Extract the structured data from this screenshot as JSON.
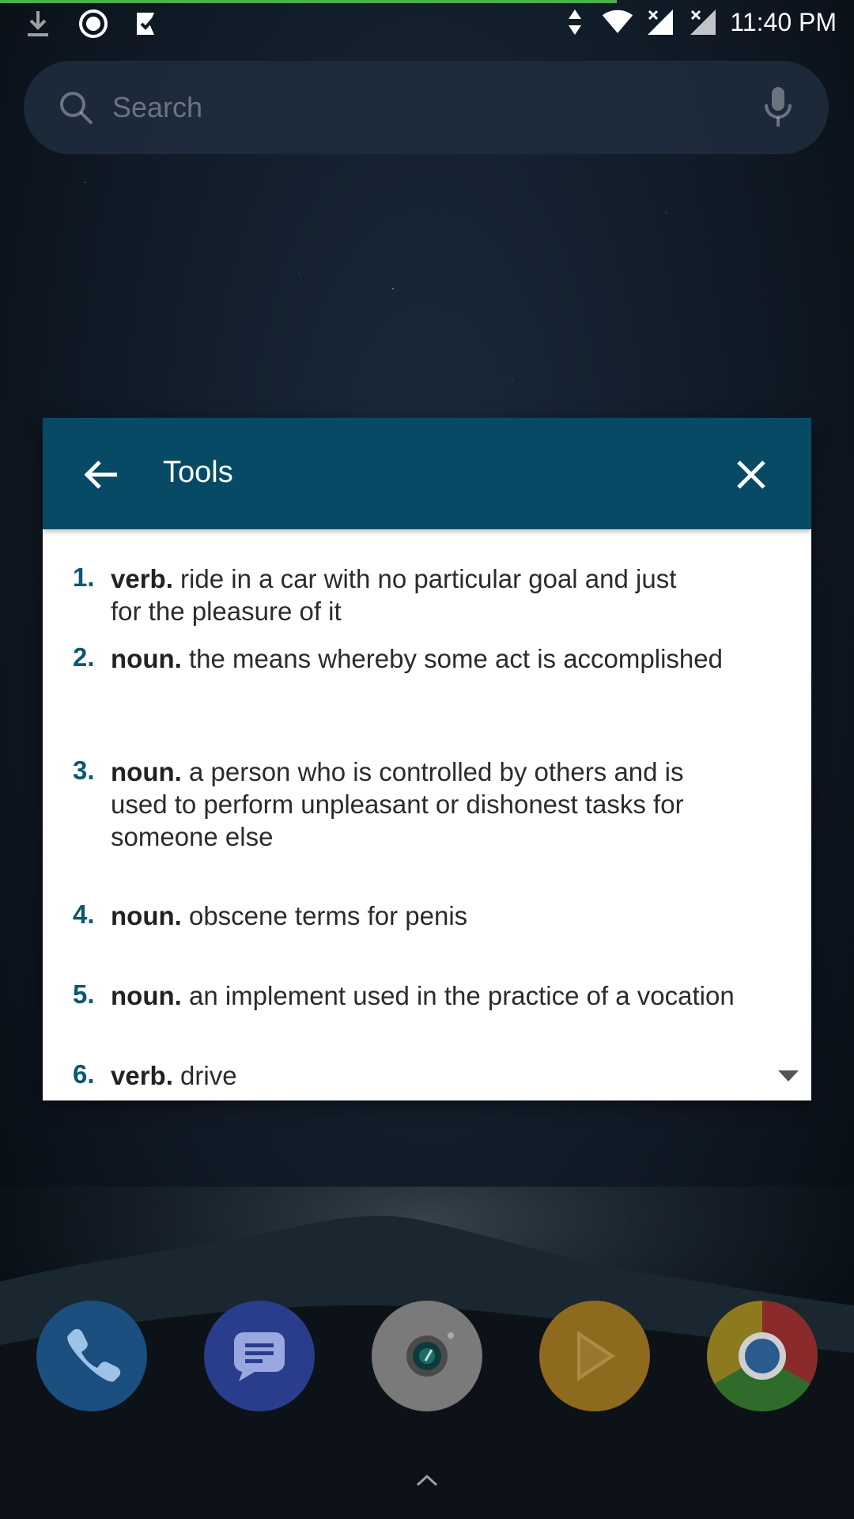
{
  "status_bar": {
    "time": "11:40 PM",
    "left_icons": [
      "download-icon",
      "record-icon",
      "check-ticket-icon"
    ],
    "right_icons": [
      "data-arrows-icon",
      "wifi-icon",
      "signal-no-sim-icon",
      "signal-no-sim-icon"
    ]
  },
  "search": {
    "placeholder": "Search"
  },
  "dialog": {
    "title": "Tools",
    "header_color": "#064a66",
    "definitions": [
      {
        "number": "1.",
        "pos": "verb.",
        "text": " ride in a car with no particular goal and just for the pleasure of it"
      },
      {
        "number": "2.",
        "pos": "noun.",
        "text": " the means whereby some act is accomplished"
      },
      {
        "number": "3.",
        "pos": "noun.",
        "text": " a person who is controlled by others and is used to perform unpleasant or dishonest tasks for someone else"
      },
      {
        "number": "4.",
        "pos": "noun.",
        "text": " obscene terms for penis"
      },
      {
        "number": "5.",
        "pos": "noun.",
        "text": " an implement used in the practice of a vocation"
      },
      {
        "number": "6.",
        "pos": "verb.",
        "text": " drive"
      }
    ]
  },
  "dock": {
    "apps": [
      "phone-app-icon",
      "messages-app-icon",
      "camera-app-icon",
      "play-store-app-icon",
      "chrome-app-icon"
    ]
  }
}
